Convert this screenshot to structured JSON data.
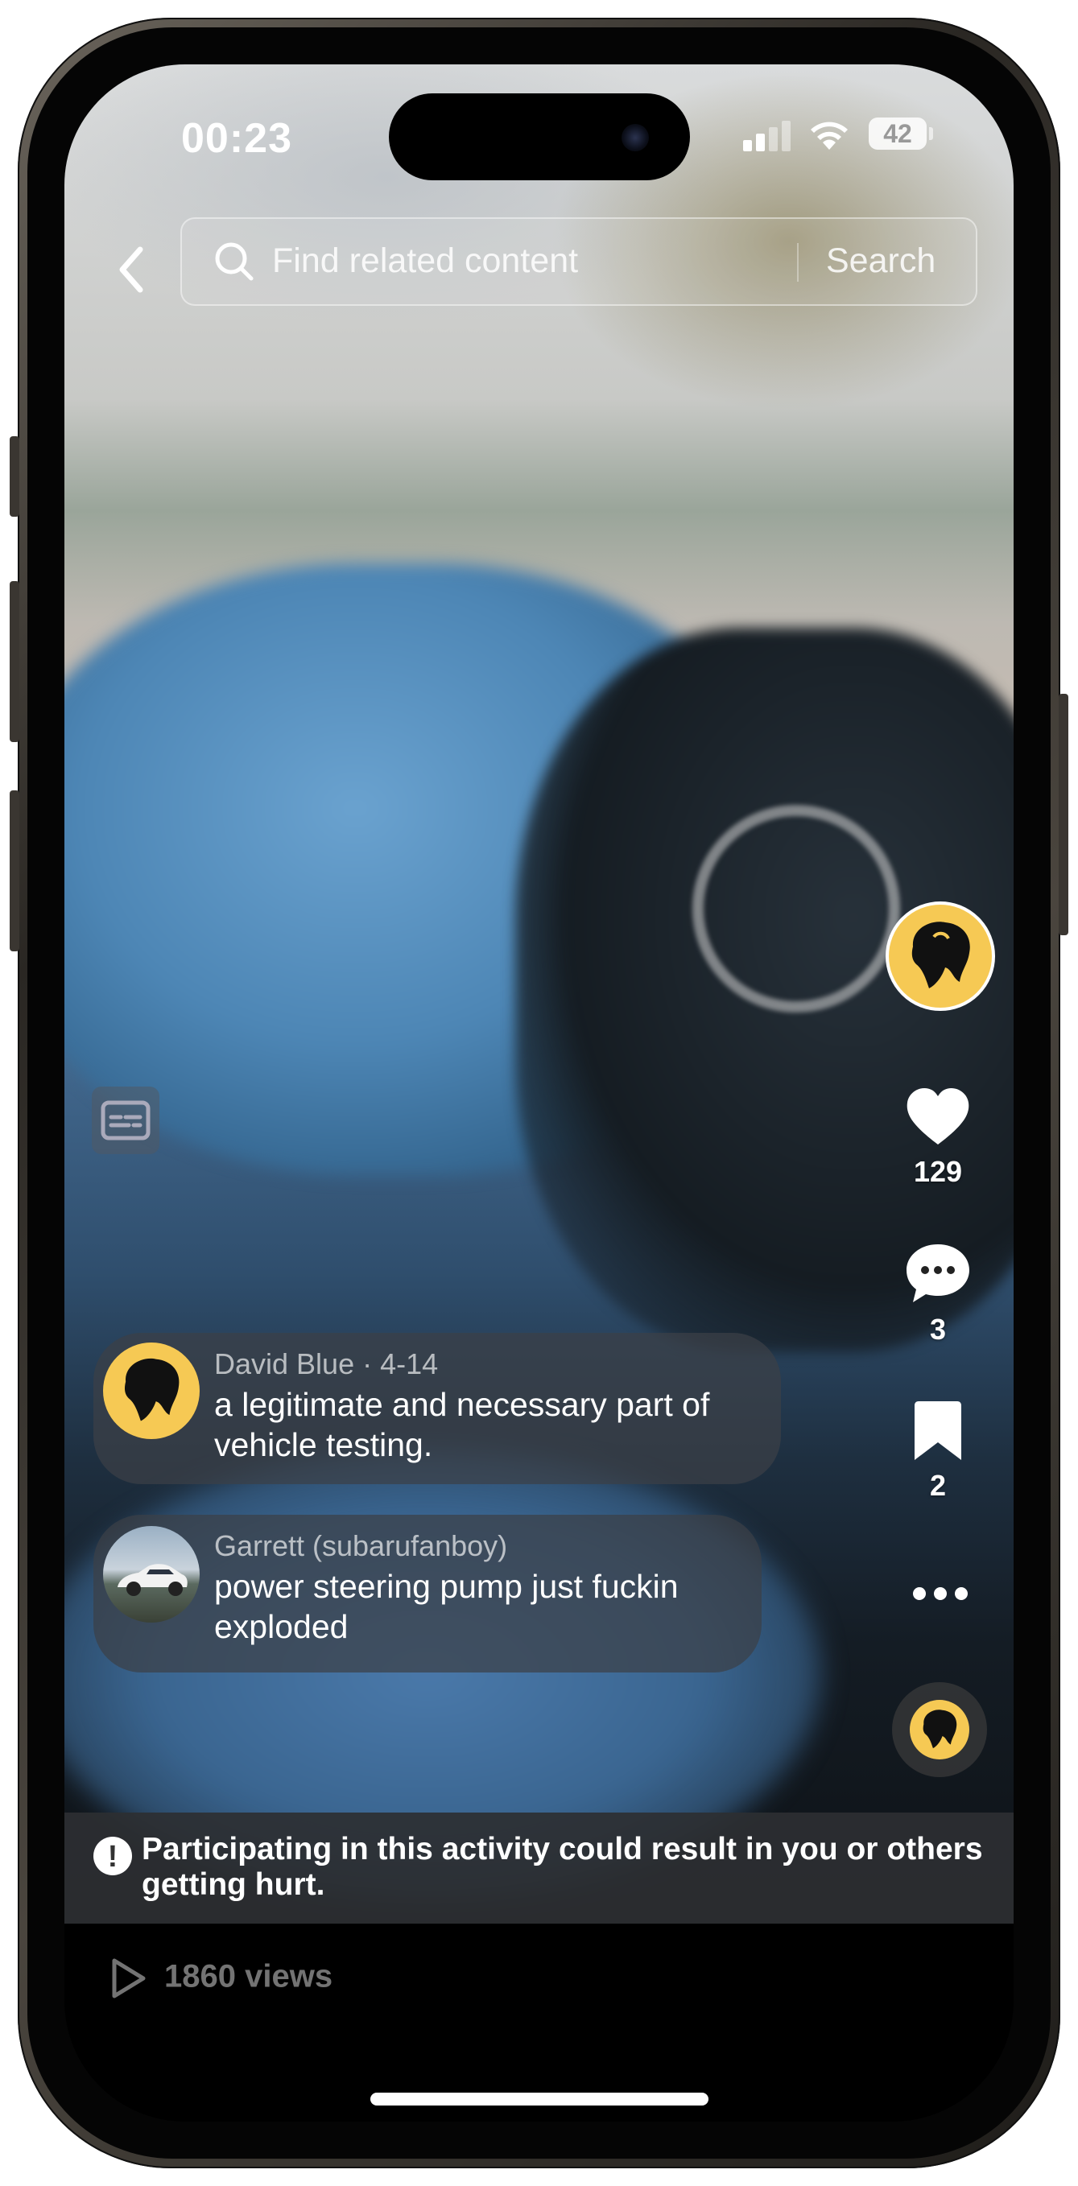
{
  "status_bar": {
    "time": "00:23",
    "battery": "42"
  },
  "search": {
    "placeholder": "Find related content",
    "button_label": "Search"
  },
  "rail": {
    "likes": "129",
    "comments": "3",
    "saves": "2"
  },
  "comments": [
    {
      "author_meta": "David Blue · 4-14",
      "text": "a legitimate and necessary part of vehicle testing."
    },
    {
      "author_meta": "Garrett (subarufanboy)",
      "text": "power steering pump just fuckin exploded"
    }
  ],
  "warning": {
    "text": "Participating in this activity could result in you or others getting hurt."
  },
  "footer": {
    "views": "1860 views"
  },
  "colors": {
    "accent_avatar": "#f6c954",
    "warning_bg": "#2d2f32"
  }
}
